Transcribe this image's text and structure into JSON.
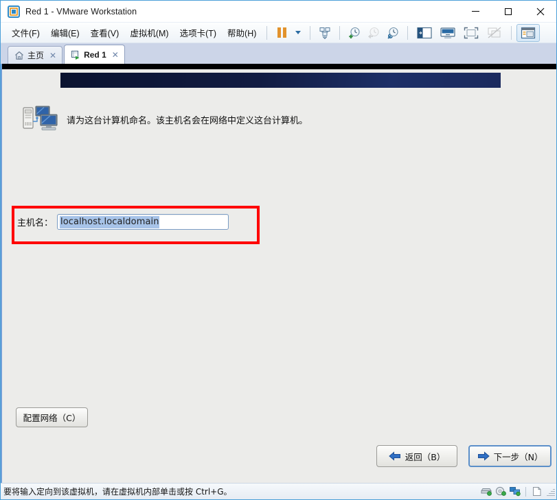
{
  "window": {
    "title": "Red 1 - VMware Workstation",
    "app_icon": "vmware-logo-icon",
    "minimize_label": "─",
    "maximize_label": "□",
    "close_label": "✕"
  },
  "menubar": {
    "items": [
      {
        "label": "文件(F)",
        "name": "menu-file"
      },
      {
        "label": "编辑(E)",
        "name": "menu-edit"
      },
      {
        "label": "查看(V)",
        "name": "menu-view"
      },
      {
        "label": "虚拟机(M)",
        "name": "menu-vm"
      },
      {
        "label": "选项卡(T)",
        "name": "menu-tabs"
      },
      {
        "label": "帮助(H)",
        "name": "menu-help"
      }
    ]
  },
  "toolbar": {
    "buttons": [
      {
        "name": "suspend-vm-button",
        "icon": "pause-icon",
        "enabled": true
      },
      {
        "name": "power-dropdown-button",
        "icon": "chevron-down-icon",
        "enabled": true
      },
      {
        "name": "send-ctrl-alt-del-button",
        "icon": "send-key-icon",
        "enabled": true
      },
      {
        "name": "take-snapshot-button",
        "icon": "snapshot-add-icon",
        "enabled": true
      },
      {
        "name": "revert-snapshot-button",
        "icon": "snapshot-revert-icon",
        "enabled": false
      },
      {
        "name": "snapshot-manager-button",
        "icon": "snapshot-manager-icon",
        "enabled": true
      },
      {
        "name": "show-library-button",
        "icon": "sidebar-panel-icon",
        "enabled": true
      },
      {
        "name": "show-console-view-button",
        "icon": "console-view-icon",
        "enabled": true
      },
      {
        "name": "enter-fullscreen-button",
        "icon": "fullscreen-icon",
        "enabled": true
      },
      {
        "name": "unity-mode-button",
        "icon": "unity-mode-icon",
        "enabled": false
      },
      {
        "name": "preferences-button",
        "icon": "window-preferences-icon",
        "enabled": true,
        "active": true
      }
    ]
  },
  "tabs": [
    {
      "label": "主页",
      "icon": "home-icon",
      "active": false,
      "close": "✕"
    },
    {
      "label": "Red 1",
      "icon": "virtual-machine-icon",
      "active": true,
      "close": "✕"
    }
  ],
  "guest": {
    "banner_color": "#111c42",
    "description": "请为这台计算机命名。该主机名会在网络中定义这台计算机。",
    "description_icon": "network-computers-icon",
    "hostname_label": "主机名：",
    "hostname_value": "localhost.localdomain",
    "hostname_placeholder": "localhost.localdomain",
    "hostname_selected": true,
    "highlight_color": "#ff0000",
    "configure_network_label": "配置网络（C）",
    "back_label": "返回（B）",
    "next_label": "下一步（N）",
    "back_icon": "arrow-left-icon",
    "next_icon": "arrow-right-icon"
  },
  "statusbar": {
    "message": "要将输入定向到该虚拟机，请在虚拟机内部单击或按 Ctrl+G。",
    "tray": [
      {
        "name": "hard-disk-icon"
      },
      {
        "name": "cd-dvd-icon"
      },
      {
        "name": "network-adapter-icon"
      },
      {
        "name": "printer-icon"
      }
    ]
  }
}
